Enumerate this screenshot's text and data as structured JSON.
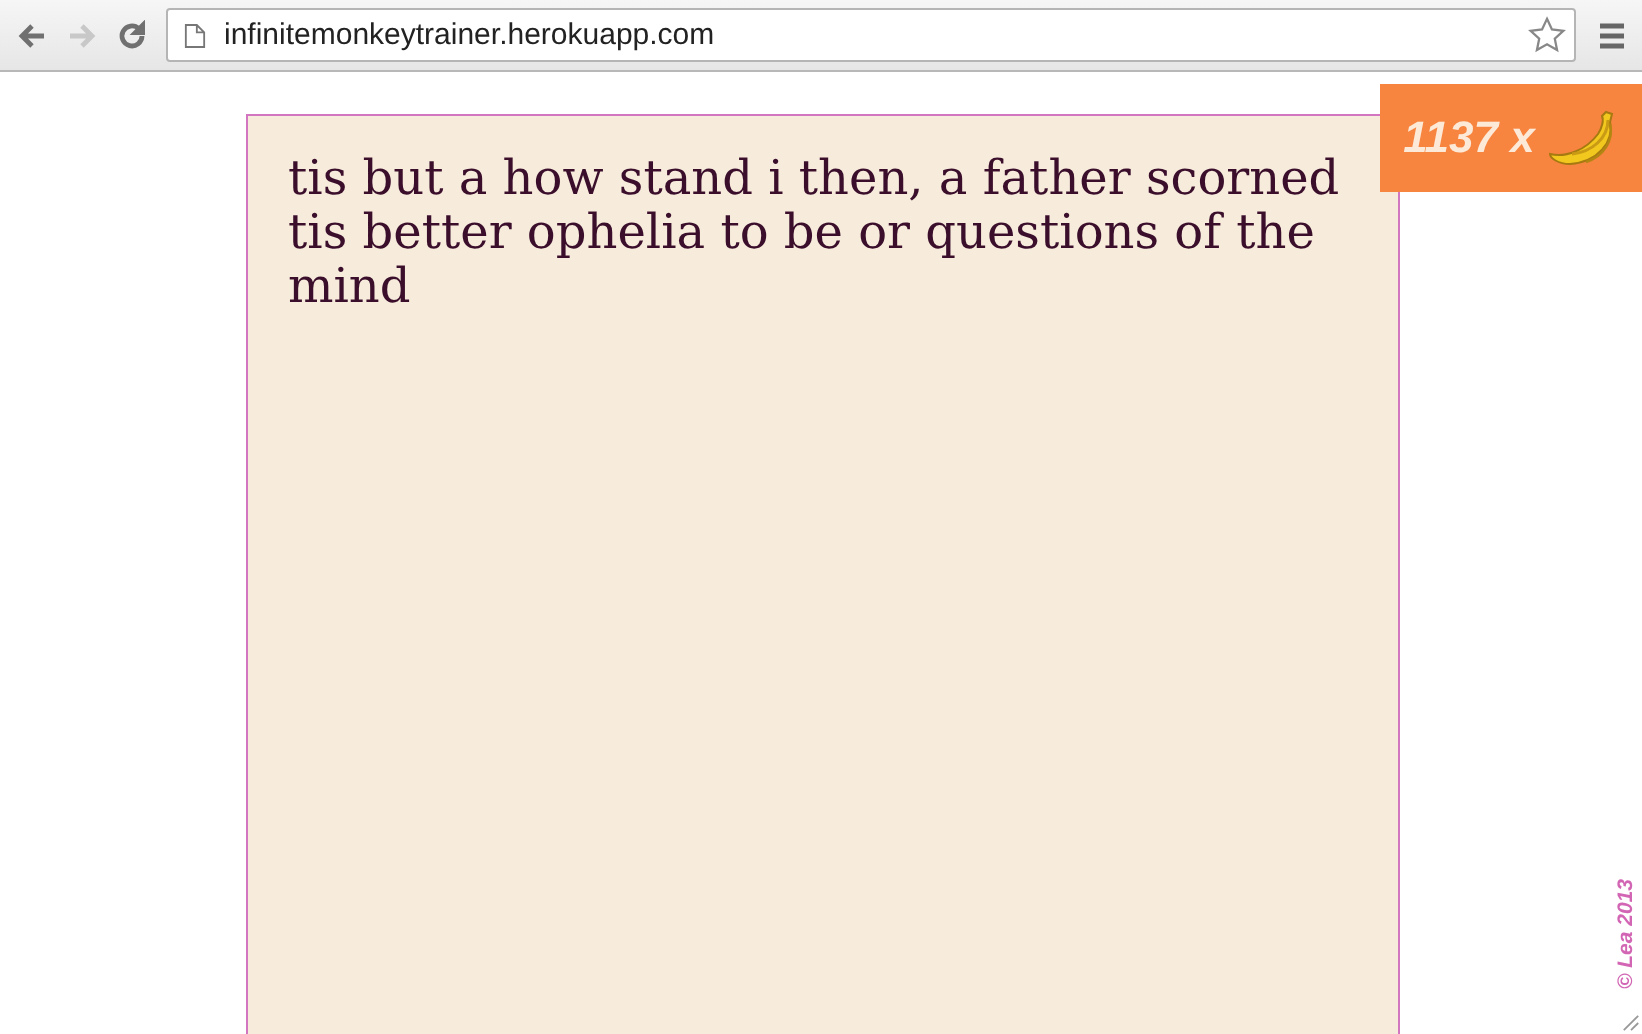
{
  "browser": {
    "url": "infinitemonkeytrainer.herokuapp.com",
    "back": {
      "disabled": false
    },
    "forward": {
      "disabled": true
    }
  },
  "paper": {
    "text": "tis but a how stand i then, a father scorned tis better ophelia to be or questions of the mind"
  },
  "counter": {
    "count": "1137 x"
  },
  "credit": "© Lea 2013"
}
